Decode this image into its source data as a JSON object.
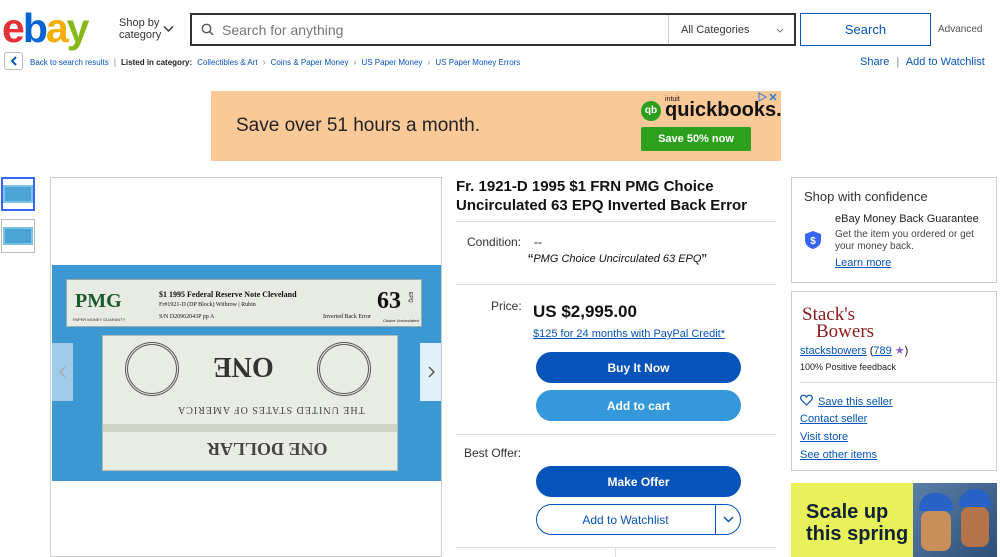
{
  "header": {
    "logo": {
      "e": "e",
      "b": "b",
      "a": "a",
      "y": "y"
    },
    "shop_by": "Shop by",
    "category": "category",
    "search_placeholder": "Search for anything",
    "category_select": "All Categories",
    "search_button": "Search",
    "advanced": "Advanced"
  },
  "breadcrumb": {
    "back": "Back to search results",
    "listed_in": "Listed in category:",
    "items": [
      "Collectibles & Art",
      "Coins & Paper Money",
      "US Paper Money",
      "US Paper Money Errors"
    ],
    "share": "Share",
    "add_watchlist": "Add to Watchlist"
  },
  "ad": {
    "headline": "Save over 51 hours a month.",
    "brand": "quickbooks.",
    "brand_badge": "qb",
    "intuit": "intuit",
    "cta": "Save 50% now",
    "colors": {
      "background": "#fbc998",
      "cta": "#2ca01c"
    }
  },
  "image": {
    "pmg": "PMG",
    "pmg_sub": "PAPER MONEY GUARANTY",
    "line1": "$1 1995  Federal Reserve Note Cleveland",
    "line2": "Fr#1921-D (DP Block)  Withrow | Rubin",
    "line3": "S/N D20962043P pp A",
    "error": "Inverted Back Error",
    "grade": "63",
    "epq": "EPQ",
    "grade_text": "Choice Uncirculated",
    "note_word": "ONE",
    "note_text": "THE UNITED STATES OF AMERICA",
    "note_bottom": "ONE DOLLAR"
  },
  "item": {
    "title": "Fr. 1921-D 1995 $1 FRN PMG Choice Uncirculated 63 EPQ Inverted Back Error",
    "condition_label": "Condition:",
    "condition_value": "--",
    "condition_desc": "PMG Choice Uncirculated 63 EPQ",
    "price_label": "Price:",
    "price": "US $2,995.00",
    "credit": "$125 for 24 months with PayPal Credit*",
    "buy_now": "Buy It Now",
    "add_to_cart": "Add to cart",
    "offer_label": "Best Offer:",
    "make_offer": "Make Offer",
    "add_watchlist": "Add to Watchlist"
  },
  "confidence": {
    "title": "Shop with confidence",
    "mbg_title": "eBay Money Back Guarantee",
    "mbg_desc": "Get the item you ordered or get your money back.",
    "learn_more": "Learn more"
  },
  "seller": {
    "logo_line1": "Stack's",
    "logo_line2": "Bowers",
    "name": "stacksbowers",
    "score": "789",
    "feedback": "100% Positive feedback",
    "save": "Save this seller",
    "contact": "Contact seller",
    "visit": "Visit store",
    "other": "See other items"
  },
  "promo": {
    "text": "Scale up this spring"
  }
}
